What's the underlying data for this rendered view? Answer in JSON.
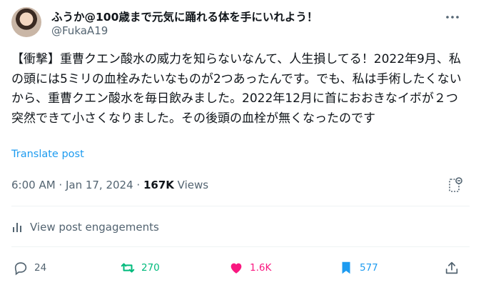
{
  "user": {
    "display_name": "ふうか@100歳まで元気に踊れる体を手にいれよう！",
    "handle": "@FukaA19"
  },
  "tweet": {
    "text": "【衝撃】重曹クエン酸水の威力を知らないなんて、人生損してる！2022年9月、私の頭には5ミリの血栓みたいなものが2つあったんです。でも、私は手術したくないから、重曹クエン酸水を毎日飲みました。2022年12月に首におおきなイボが２つ突然できて小さくなりました。その後頭の血栓が無くなったのです",
    "translate_label": "Translate post",
    "timestamp": "6:00 AM · Jan 17, 2024 · ",
    "views_count": "167K",
    "views_label": " Views"
  },
  "engagements_label": "View post engagements",
  "actions": {
    "replies": "24",
    "retweets": "270",
    "likes": "1.6K",
    "bookmarks": "577"
  },
  "colors": {
    "accent": "#1d9bf0",
    "retweet": "#00ba7c",
    "like": "#f91880",
    "muted": "#536471"
  }
}
